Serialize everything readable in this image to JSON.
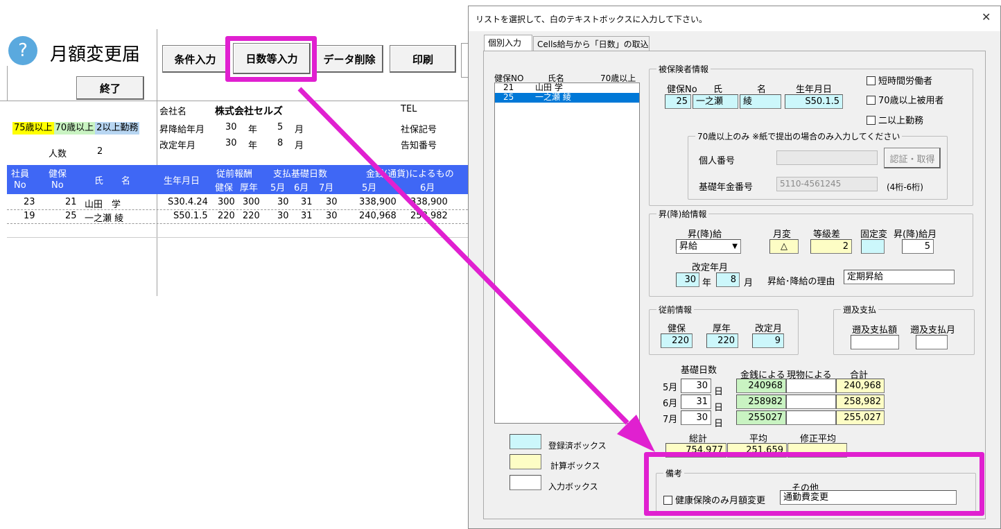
{
  "sheet": {
    "title": "月額変更届",
    "buttons": {
      "condition": "条件入力",
      "days": "日数等入力",
      "delete": "データ削除",
      "print": "印刷",
      "exit": "終了"
    },
    "legend": {
      "age75": "75歳以上",
      "age70": "70歳以上",
      "dual": "2以上勤務"
    },
    "count_label": "人数",
    "count_value": "2",
    "company_label": "会社名",
    "company_name": "株式会社セルズ",
    "tel_label": "TEL",
    "raise_label": "昇降給年月",
    "raise_year": "30",
    "raise_year_unit": "年",
    "raise_month": "5",
    "raise_month_unit": "月",
    "revise_label": "改定年月",
    "revise_year": "30",
    "revise_year_unit": "年",
    "revise_month": "8",
    "revise_month_unit": "月",
    "social_label": "社保記号",
    "notice_label": "告知番号",
    "header": {
      "emp": "社員",
      "emp_no": "No",
      "kenpo": "健保",
      "kenpo_no": "No",
      "name": "氏　　名",
      "birth": "生年月日",
      "prev": "従前報酬",
      "prev_k": "健保",
      "prev_n": "厚年",
      "days": "支払基礎日数",
      "d5": "5月",
      "d6": "6月",
      "d7": "7月",
      "money": "金銭(通貨)によるもの",
      "m5": "5月",
      "m6": "6月"
    },
    "rows": [
      {
        "emp": "23",
        "kenpo": "21",
        "name": "山田　学",
        "birth": "S30.4.24",
        "k": "300",
        "n": "300",
        "d5": "30",
        "d6": "31",
        "d7": "30",
        "m5": "338,900",
        "m6": "338,900"
      },
      {
        "emp": "19",
        "kenpo": "25",
        "name": "一之瀬 綾",
        "birth": "S50.1.5",
        "k": "220",
        "n": "220",
        "d5": "30",
        "d6": "31",
        "d7": "30",
        "m5": "240,968",
        "m6": "258,982"
      }
    ]
  },
  "dialog": {
    "title": "リストを選択して、白のテキストボックスに入力して下さい。",
    "close": "✕",
    "tabs": [
      "個別入力",
      "Cells給与から「日数」の取込"
    ],
    "list_header": {
      "no": "健保NO",
      "name": "氏名",
      "age": "70歳以上"
    },
    "list_items": [
      {
        "no": "21",
        "name": "山田 学"
      },
      {
        "no": "25",
        "name": "一之瀬 綾"
      }
    ],
    "insured": {
      "group": "被保険者情報",
      "no_label": "健保No",
      "sei_label": "氏",
      "mei_label": "名",
      "birth_label": "生年月日",
      "no": "25",
      "sei": "一之瀬",
      "mei": "綾",
      "birth": "S50.1.5",
      "cb_short": "短時間労働者",
      "cb_70": "70歳以上被用者",
      "cb_dual": "二以上勤務",
      "over70_group": "70歳以上のみ ※紙で提出の場合のみ入力してください",
      "mynumber_label": "個人番号",
      "auth_button": "認証・取得",
      "pension_label": "基礎年金番号",
      "pension": "5110-4561245",
      "pension_note": "(4桁-6桁)"
    },
    "raise": {
      "group": "昇(降)給情報",
      "kind_label": "昇(降)給",
      "kind": "昇給",
      "change_label": "月変",
      "change": "△",
      "grade_label": "等級差",
      "grade": "2",
      "fixed_label": "固定変",
      "month_label": "昇(降)給月",
      "month": "5",
      "revise_label": "改定年月",
      "year": "30",
      "year_unit": "年",
      "rmonth": "8",
      "rmonth_unit": "月",
      "reason_label": "昇給･降給の理由",
      "reason": "定期昇給"
    },
    "prev": {
      "group": "従前情報",
      "k_label": "健保",
      "n_label": "厚年",
      "m_label": "改定月",
      "k": "220",
      "n": "220",
      "m": "9"
    },
    "retro": {
      "group": "遡及支払",
      "amount_label": "遡及支払額",
      "month_label": "遡及支払月"
    },
    "basis": {
      "days_label": "基礎日数",
      "money_label": "金銭による",
      "goods_label": "現物による",
      "total_label": "合計",
      "day_unit": "日",
      "rows": [
        {
          "m": "5月",
          "d": "30",
          "money": "240968",
          "total": "240,968"
        },
        {
          "m": "6月",
          "d": "31",
          "money": "258982",
          "total": "258,982"
        },
        {
          "m": "7月",
          "d": "30",
          "money": "255027",
          "total": "255,027"
        }
      ],
      "sum_label": "総計",
      "avg_label": "平均",
      "fix_label": "修正平均",
      "sum": "754,977",
      "avg": "251,659"
    },
    "legend": {
      "registered": "登録済ボックス",
      "calc": "計算ボックス",
      "input": "入力ボックス"
    },
    "notes": {
      "group": "備考",
      "cb_label": "健康保険のみ月額変更",
      "other_label": "その他",
      "other": "通勤費変更"
    }
  },
  "colors": {
    "highlight": "#e020d0",
    "header_blue": "#3f67f5",
    "selection": "#0078d7"
  }
}
